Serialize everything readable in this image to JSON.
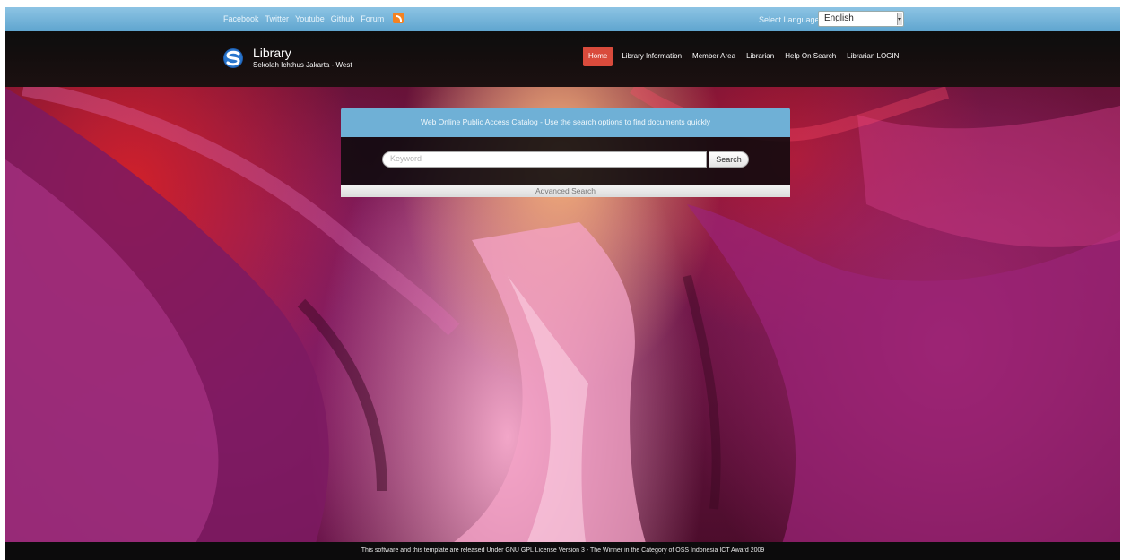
{
  "topbar": {
    "social_links": [
      "Facebook",
      "Twitter",
      "Youtube",
      "Github",
      "Forum"
    ],
    "rss_icon": "rss-icon",
    "language_label": "Select Language",
    "language_selected": "English"
  },
  "brand": {
    "title": "Library",
    "subtitle": "Sekolah Ichthus Jakarta - West"
  },
  "nav": {
    "items": [
      {
        "label": "Home",
        "active": true
      },
      {
        "label": "Library Information",
        "active": false
      },
      {
        "label": "Member Area",
        "active": false
      },
      {
        "label": "Librarian",
        "active": false
      },
      {
        "label": "Help On Search",
        "active": false
      },
      {
        "label": "Librarian LOGIN",
        "active": false
      }
    ]
  },
  "search": {
    "header": "Web Online Public Access Catalog - Use the search options to find documents quickly",
    "placeholder": "Keyword",
    "button_label": "Search",
    "advanced_label": "Advanced Search"
  },
  "footer": {
    "text": "This software and this template are released Under GNU GPL License Version 3 - The Winner in the Category of OSS Indonesia ICT Award 2009"
  },
  "colors": {
    "topbar": "#6fb0d6",
    "nav_active": "#d94b3c",
    "navbar": "#0d0d0d"
  }
}
